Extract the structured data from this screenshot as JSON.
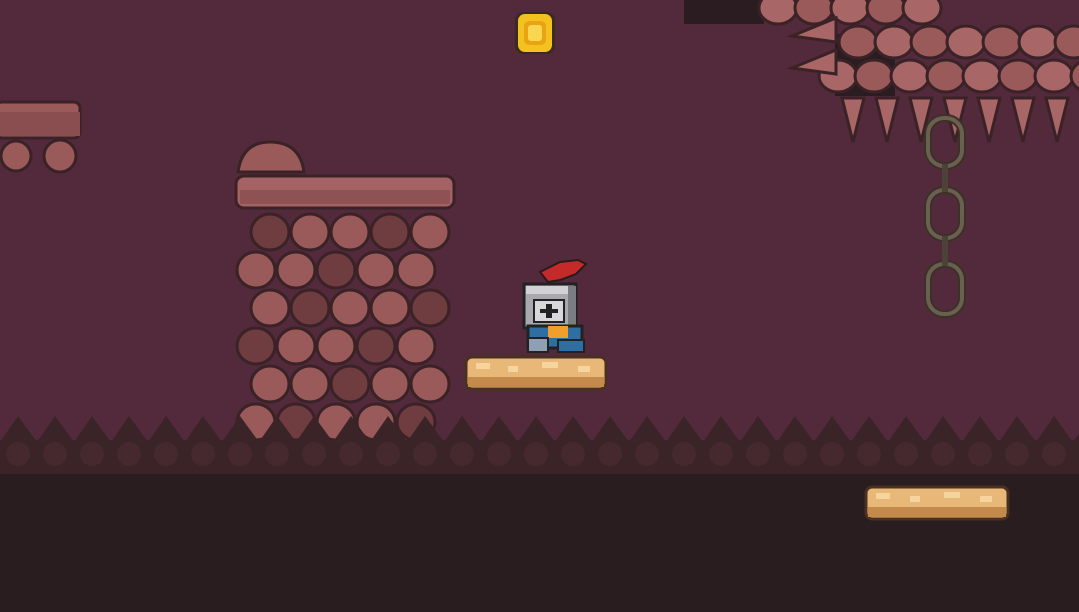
{
  "scene": {
    "type": "2d-pixel-platformer",
    "player": {
      "character": "knight",
      "helmet": "grey",
      "plume_color": "#c42a2a",
      "tunic_color": "#2f6ea3",
      "facing": "right"
    },
    "collectibles": [
      {
        "kind": "gold-coin",
        "count": 1
      }
    ],
    "hazards": [
      "ceiling-spikes",
      "wall-spikes"
    ],
    "props": [
      "hanging-chain",
      "cobblestone-pillar",
      "floating-sandstone-platform"
    ]
  },
  "colors": {
    "background": "#532a3b",
    "ground": "#2a1d20",
    "stone_face": "#9a5a5a",
    "stone_shadow": "#6f3c40",
    "stone_outline": "#3a2226",
    "sand": "#e8b878",
    "coin": "#f4c21f",
    "chain": "#5c5145"
  }
}
